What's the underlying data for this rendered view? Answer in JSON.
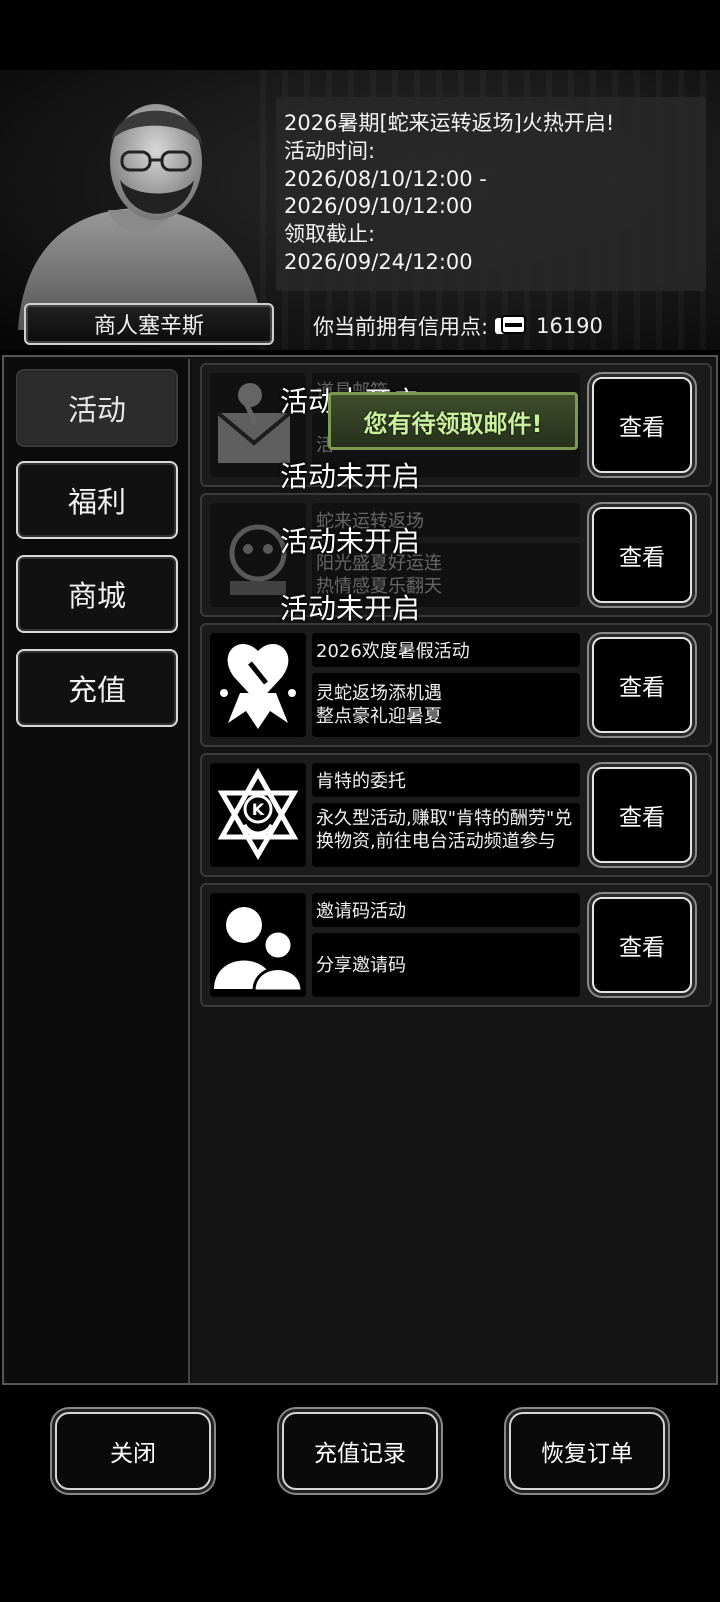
{
  "header": {
    "merchant_name": "商人塞辛斯",
    "notice": "2026暑期[蛇来运转返场]火热开启!\n活动时间:\n2026/08/10/12:00 -\n2026/09/10/12:00\n领取截止:\n2026/09/24/12:00",
    "credits_label": "你当前拥有信用点:",
    "credits_value": "16190"
  },
  "sidebar": {
    "items": [
      {
        "label": "活动",
        "active": true
      },
      {
        "label": "福利",
        "active": false
      },
      {
        "label": "商城",
        "active": false
      },
      {
        "label": "充值",
        "active": false
      }
    ]
  },
  "cards": [
    {
      "title": "道具邮箱",
      "desc": "活",
      "button": "查看",
      "icon": "mail-icon"
    },
    {
      "title": "蛇来运转返场",
      "desc": "阳光盛夏好运连\n热情感夏乐翻天",
      "button": "查看",
      "icon": "snake-icon"
    },
    {
      "title": "2026欢度暑假活动",
      "desc": "灵蛇返场添机遇\n整点豪礼迎暑夏",
      "button": "查看",
      "icon": "summer-event-icon"
    },
    {
      "title": "肯特的委托",
      "desc": "永久型活动,赚取\"肯特的酬劳\"兑换物资,前往电台活动频道参与",
      "button": "查看",
      "icon": "kent-badge-icon"
    },
    {
      "title": "邀请码活动",
      "desc": "分享邀请码",
      "button": "查看",
      "icon": "users-icon"
    }
  ],
  "overlays": {
    "inactive_text": "活动未开启",
    "mail_banner": "您有待领取邮件!"
  },
  "bottom": {
    "close": "关闭",
    "recharge_history": "充值记录",
    "restore_order": "恢复订单"
  }
}
